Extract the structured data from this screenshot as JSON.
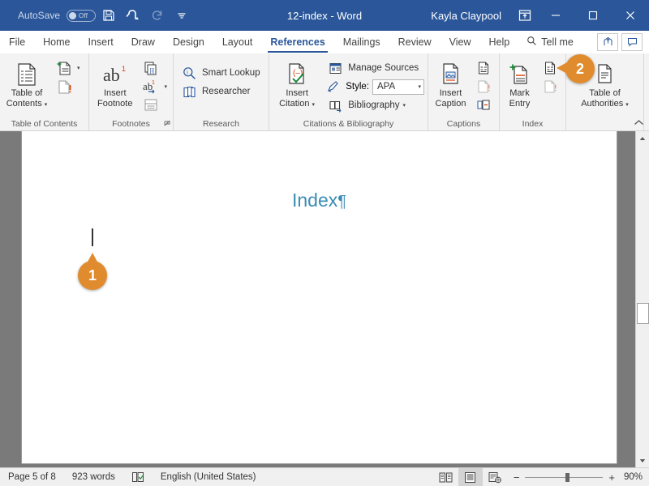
{
  "titlebar": {
    "autosave_label": "AutoSave",
    "autosave_state": "Off",
    "save_icon": "save-icon",
    "undo_icon": "undo-icon",
    "redo_icon": "redo-icon",
    "customize_icon": "customize-quick-access-icon",
    "document_title": "12-index - Word",
    "account_name": "Kayla Claypool",
    "ribbon_display_icon": "ribbon-display-options-icon",
    "minimize_icon": "minimize-icon",
    "maximize_icon": "maximize-icon",
    "close_icon": "close-icon",
    "bg_color": "#2b579a"
  },
  "tabs": [
    {
      "label": "File",
      "active": false
    },
    {
      "label": "Home",
      "active": false
    },
    {
      "label": "Insert",
      "active": false
    },
    {
      "label": "Draw",
      "active": false
    },
    {
      "label": "Design",
      "active": false
    },
    {
      "label": "Layout",
      "active": false
    },
    {
      "label": "References",
      "active": true
    },
    {
      "label": "Mailings",
      "active": false
    },
    {
      "label": "Review",
      "active": false
    },
    {
      "label": "View",
      "active": false
    },
    {
      "label": "Help",
      "active": false
    }
  ],
  "tellme": {
    "label": "Tell me",
    "icon": "search-icon"
  },
  "tab_right": {
    "share_icon": "share-icon",
    "comments_icon": "comments-icon"
  },
  "ribbon": {
    "accent_color": "#2b579a",
    "collapse_label": "collapse-ribbon-icon",
    "groups": [
      {
        "name": "table-of-contents",
        "label": "Table of Contents",
        "big_button": {
          "label_line1": "Table of",
          "label_line2": "Contents",
          "icon": "table-of-contents-icon",
          "has_caret": true
        },
        "small_buttons": [
          {
            "label": "",
            "icon": "add-text-icon",
            "has_caret": true
          },
          {
            "label": "",
            "icon": "update-table-icon",
            "has_caret": false
          }
        ]
      },
      {
        "name": "footnotes",
        "label": "Footnotes",
        "big_button": {
          "label_line1": "Insert",
          "label_line2": "Footnote",
          "icon": "insert-footnote-icon",
          "has_caret": false
        },
        "small_buttons": [
          {
            "label": "",
            "icon": "insert-endnote-icon",
            "has_caret": false
          },
          {
            "label": "",
            "icon": "next-footnote-icon",
            "has_caret": true
          },
          {
            "label": "",
            "icon": "show-notes-icon",
            "has_caret": false
          }
        ],
        "has_launcher": true
      },
      {
        "name": "research",
        "label": "Research",
        "small_buttons": [
          {
            "label": "Smart Lookup",
            "icon": "smart-lookup-icon",
            "has_caret": false
          },
          {
            "label": "Researcher",
            "icon": "researcher-icon",
            "has_caret": false
          }
        ]
      },
      {
        "name": "citations-bibliography",
        "label": "Citations & Bibliography",
        "big_button": {
          "label_line1": "Insert",
          "label_line2": "Citation",
          "icon": "insert-citation-icon",
          "has_caret": true
        },
        "small_buttons": [
          {
            "label": "Manage Sources",
            "icon": "manage-sources-icon",
            "has_caret": false
          },
          {
            "label": "Bibliography",
            "icon": "bibliography-icon",
            "has_caret": true
          }
        ],
        "style_row": {
          "icon": "style-icon",
          "label": "Style:",
          "value": "APA"
        }
      },
      {
        "name": "captions",
        "label": "Captions",
        "big_button": {
          "label_line1": "Insert",
          "label_line2": "Caption",
          "icon": "insert-caption-icon",
          "has_caret": false
        },
        "small_buttons": [
          {
            "label": "",
            "icon": "insert-table-of-figures-icon",
            "has_caret": false
          },
          {
            "label": "",
            "icon": "update-table-figures-icon",
            "has_caret": false
          },
          {
            "label": "",
            "icon": "cross-reference-icon",
            "has_caret": false
          }
        ]
      },
      {
        "name": "index",
        "label": "Index",
        "big_button": {
          "label_line1": "Mark",
          "label_line2": "Entry",
          "icon": "mark-entry-icon",
          "has_caret": false
        },
        "small_buttons": [
          {
            "label": "",
            "icon": "insert-index-icon",
            "has_caret": false
          },
          {
            "label": "",
            "icon": "update-index-icon",
            "has_caret": false
          }
        ]
      },
      {
        "name": "table-of-authorities",
        "label": "",
        "big_button": {
          "label_line1": "Table of",
          "label_line2": "Authorities",
          "icon": "table-of-authorities-icon",
          "has_caret": true
        },
        "small_buttons": []
      }
    ]
  },
  "document": {
    "heading": "Index",
    "pilcrow": "¶",
    "heading_color": "#3b8cb5",
    "cursor": "text-cursor"
  },
  "callouts": [
    {
      "number": "1",
      "direction": "up",
      "target": "text-cursor-in-document",
      "color": "#e08b2e"
    },
    {
      "number": "2",
      "direction": "left",
      "target": "insert-index-button",
      "color": "#e08b2e"
    }
  ],
  "scrollbar": {
    "up_arrow_icon": "scroll-up-icon",
    "down_arrow_icon": "scroll-down-icon",
    "thumb": "scroll-thumb"
  },
  "statusbar": {
    "page_info": "Page 5 of 8",
    "word_count": "923 words",
    "proofing_icon": "proofing-errors-icon",
    "language": "English (United States)",
    "views": [
      {
        "name": "read-mode",
        "icon": "read-mode-icon",
        "active": false
      },
      {
        "name": "print-layout",
        "icon": "print-layout-icon",
        "active": true
      },
      {
        "name": "web-layout",
        "icon": "web-layout-icon",
        "active": false
      }
    ],
    "zoom_out": "−",
    "zoom_in": "+",
    "zoom_level": "90%"
  }
}
